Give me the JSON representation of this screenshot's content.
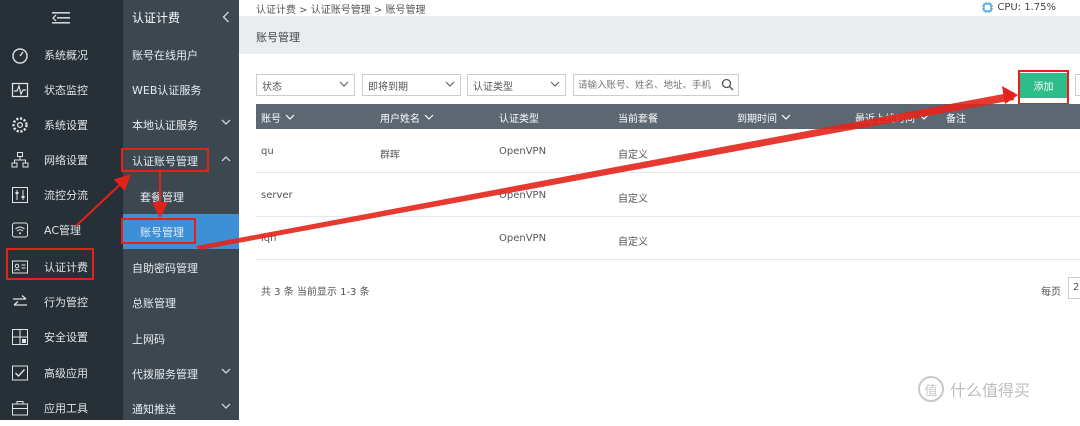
{
  "nav_primary": [
    {
      "label": "系统概况",
      "icon": "gauge-icon"
    },
    {
      "label": "状态监控",
      "icon": "pulse-monitor-icon"
    },
    {
      "label": "系统设置",
      "icon": "gear-icon"
    },
    {
      "label": "网络设置",
      "icon": "network-tree-icon"
    },
    {
      "label": "流控分流",
      "icon": "sliders-icon"
    },
    {
      "label": "AC管理",
      "icon": "wifi-icon"
    },
    {
      "label": "认证计费",
      "icon": "id-card-icon"
    },
    {
      "label": "行为管控",
      "icon": "swap-arrows-icon"
    },
    {
      "label": "安全设置",
      "icon": "grid-lock-icon"
    },
    {
      "label": "高级应用",
      "icon": "checkbox-icon"
    },
    {
      "label": "应用工具",
      "icon": "toolbox-icon"
    }
  ],
  "nav_secondary": {
    "title": "认证计费",
    "items": [
      {
        "label": "账号在线用户"
      },
      {
        "label": "WEB认证服务"
      },
      {
        "label": "本地认证服务"
      },
      {
        "label": "认证账号管理"
      },
      {
        "label": "套餐管理"
      },
      {
        "label": "账号管理"
      },
      {
        "label": "自助密码管理"
      },
      {
        "label": "总账管理"
      },
      {
        "label": "上网码"
      },
      {
        "label": "代拨服务管理"
      },
      {
        "label": "通知推送"
      }
    ]
  },
  "breadcrumb": "认证计费 > 认证账号管理 > 账号管理",
  "cpu": "CPU: 1.75%",
  "page_title": "账号管理",
  "filters": {
    "status": "状态",
    "expiry": "即将到期",
    "auth_type": "认证类型",
    "search_placeholder": "请输入账号、姓名、地址、手机"
  },
  "add_label": "添加",
  "table": {
    "headers": [
      "账号",
      "用户姓名",
      "认证类型",
      "当前套餐",
      "到期时间",
      "最近上线时间",
      "备注"
    ],
    "rows": [
      {
        "account": "qu",
        "name": "群晖",
        "type": "OpenVPN",
        "plan": "自定义"
      },
      {
        "account": "server",
        "name": "",
        "type": "OpenVPN",
        "plan": "自定义"
      },
      {
        "account": "lqh",
        "name": "",
        "type": "OpenVPN",
        "plan": "自定义"
      }
    ]
  },
  "footer": "共 3 条 当前显示 1-3 条",
  "per_page_label": "每页",
  "per_page_value": "2",
  "watermark": "什么值得买",
  "watermark_mark": "值",
  "colors": {
    "accent_red": "#e3231a",
    "add_green": "#2dbd8a",
    "active_blue": "#3d8fd6"
  }
}
